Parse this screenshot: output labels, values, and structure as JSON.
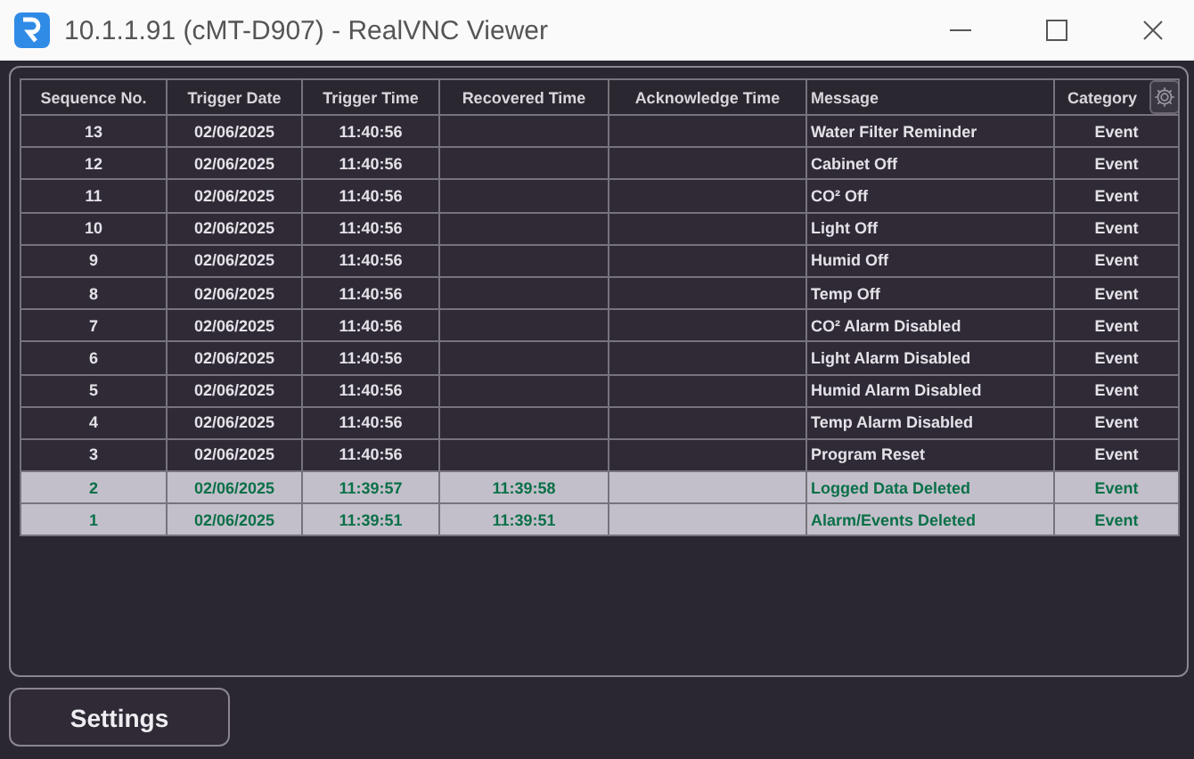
{
  "window": {
    "title": "10.1.1.91 (cMT-D907) - RealVNC Viewer"
  },
  "table": {
    "columns": [
      "Sequence No.",
      "Trigger Date",
      "Trigger Time",
      "Recovered Time",
      "Acknowledge Time",
      "Message",
      "Category"
    ],
    "rows": [
      {
        "selected": false,
        "cells": [
          "13",
          "02/06/2025",
          "11:40:56",
          "",
          "",
          "Water Filter Reminder",
          "Event"
        ]
      },
      {
        "selected": false,
        "cells": [
          "12",
          "02/06/2025",
          "11:40:56",
          "",
          "",
          "Cabinet Off",
          "Event"
        ]
      },
      {
        "selected": false,
        "cells": [
          "11",
          "02/06/2025",
          "11:40:56",
          "",
          "",
          "CO² Off",
          "Event"
        ]
      },
      {
        "selected": false,
        "cells": [
          "10",
          "02/06/2025",
          "11:40:56",
          "",
          "",
          "Light Off",
          "Event"
        ]
      },
      {
        "selected": false,
        "cells": [
          "9",
          "02/06/2025",
          "11:40:56",
          "",
          "",
          "Humid Off",
          "Event"
        ]
      },
      {
        "selected": false,
        "cells": [
          "8",
          "02/06/2025",
          "11:40:56",
          "",
          "",
          "Temp Off",
          "Event"
        ]
      },
      {
        "selected": false,
        "cells": [
          "7",
          "02/06/2025",
          "11:40:56",
          "",
          "",
          "CO² Alarm Disabled",
          "Event"
        ]
      },
      {
        "selected": false,
        "cells": [
          "6",
          "02/06/2025",
          "11:40:56",
          "",
          "",
          "Light Alarm Disabled",
          "Event"
        ]
      },
      {
        "selected": false,
        "cells": [
          "5",
          "02/06/2025",
          "11:40:56",
          "",
          "",
          "Humid Alarm Disabled",
          "Event"
        ]
      },
      {
        "selected": false,
        "cells": [
          "4",
          "02/06/2025",
          "11:40:56",
          "",
          "",
          "Temp Alarm Disabled",
          "Event"
        ]
      },
      {
        "selected": false,
        "cells": [
          "3",
          "02/06/2025",
          "11:40:56",
          "",
          "",
          "Program Reset",
          "Event"
        ]
      },
      {
        "selected": true,
        "cells": [
          "2",
          "02/06/2025",
          "11:39:57",
          "11:39:58",
          "",
          "Logged Data Deleted",
          "Event"
        ]
      },
      {
        "selected": true,
        "cells": [
          "1",
          "02/06/2025",
          "11:39:51",
          "11:39:51",
          "",
          "Alarm/Events Deleted",
          "Event"
        ]
      }
    ]
  },
  "settings_button": "Settings"
}
